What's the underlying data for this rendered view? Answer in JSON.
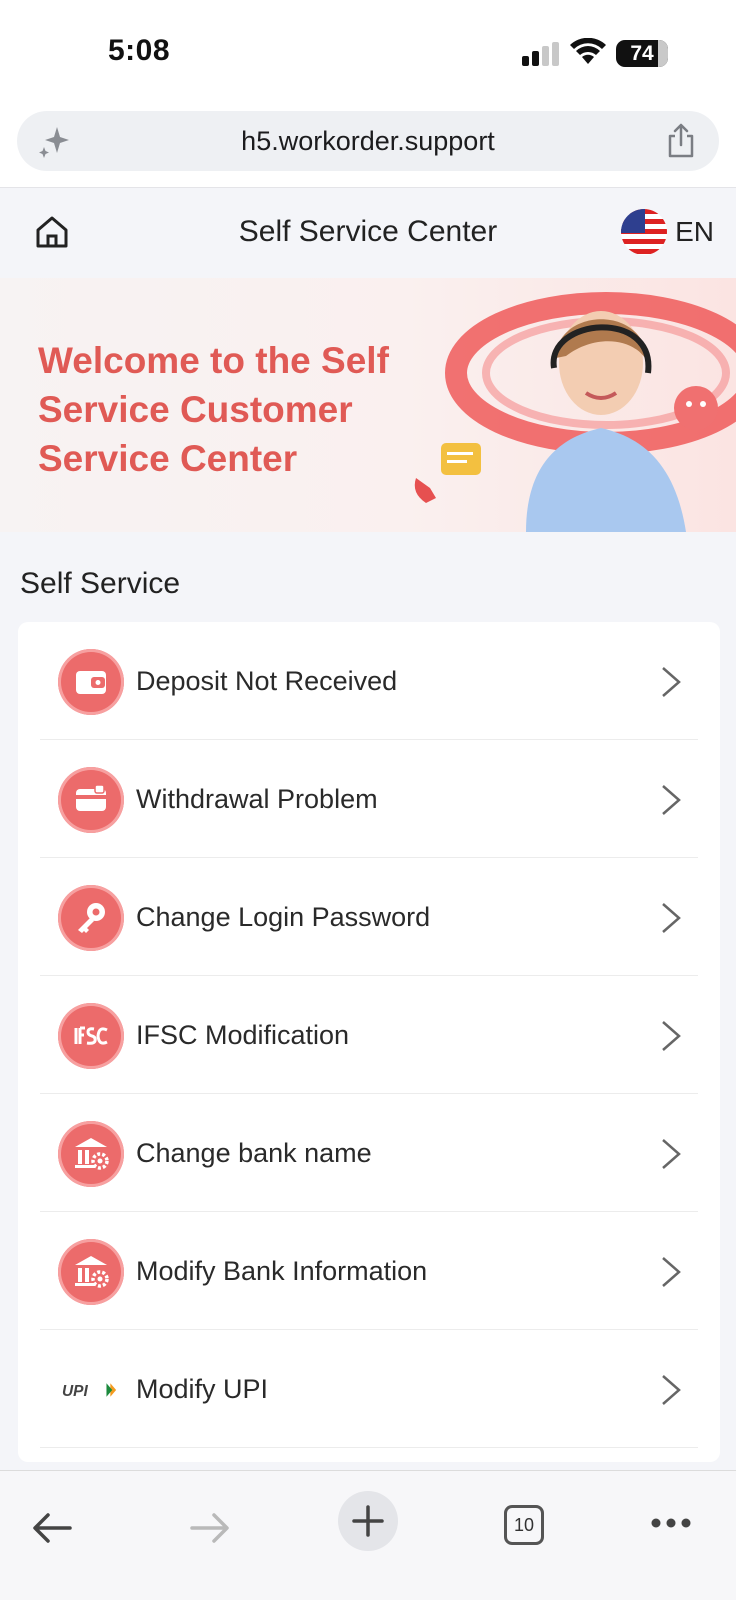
{
  "status_bar": {
    "time": "5:08",
    "battery": "74"
  },
  "browser": {
    "url": "h5.workorder.support",
    "tabs_count": "10"
  },
  "header": {
    "title": "Self Service Center",
    "language": "EN"
  },
  "banner": {
    "text": "Welcome to the Self Service Customer Service Center"
  },
  "section": {
    "title": "Self Service"
  },
  "items": [
    {
      "label": "Deposit Not Received",
      "icon": "wallet-icon"
    },
    {
      "label": "Withdrawal Problem",
      "icon": "card-icon"
    },
    {
      "label": "Change Login Password",
      "icon": "key-icon"
    },
    {
      "label": "IFSC Modification",
      "icon": "ifsc-icon"
    },
    {
      "label": "Change bank name",
      "icon": "bank-gear-icon"
    },
    {
      "label": "Modify Bank Information",
      "icon": "bank-gear-icon"
    },
    {
      "label": "Modify UPI",
      "icon": "upi-icon",
      "icon_text": "UPI"
    }
  ],
  "colors": {
    "accent": "#ec6b6b",
    "banner_text": "#e05a55",
    "background": "#f4f5f9"
  }
}
